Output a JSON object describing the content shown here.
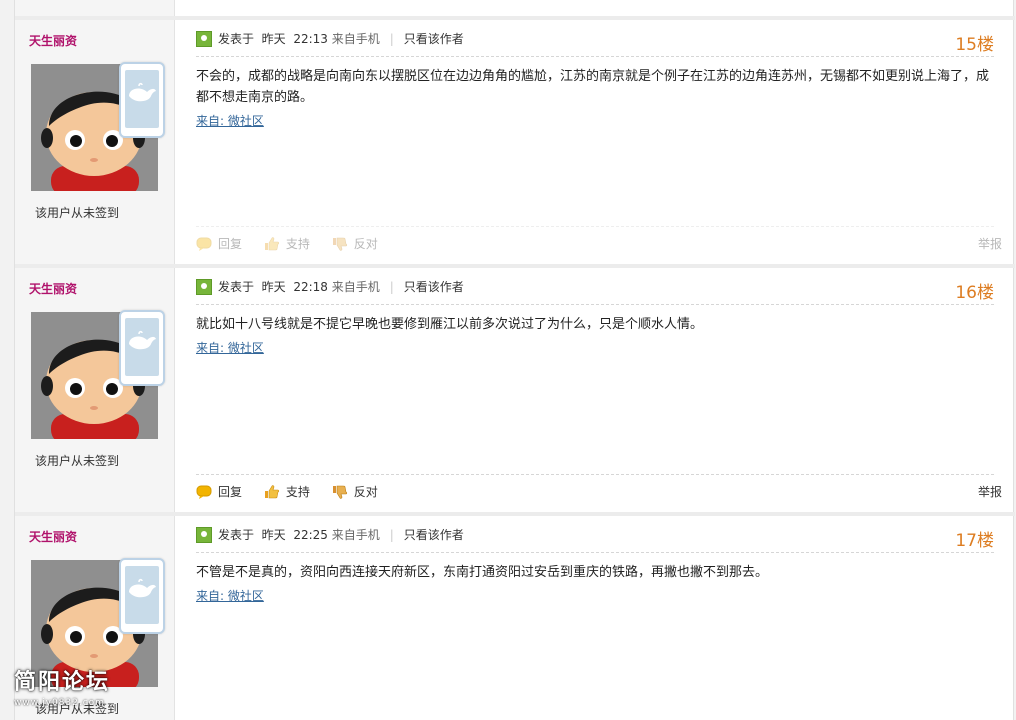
{
  "posts": [
    {
      "author": "天生丽资",
      "posted_label": "发表于",
      "date": "昨天",
      "time": "22:13",
      "device": "来自手机",
      "only_author": "只看该作者",
      "floor": "15楼",
      "content": "不会的，成都的战略是向南向东以摆脱区位在边边角角的尴尬，江苏的南京就是个例子在江苏的边角连苏州，无锡都不如更别说上海了，成都不想走南京的路。",
      "source": "来自: 微社区",
      "sign_status": "该用户从未签到",
      "reply": "回复",
      "support": "支持",
      "oppose": "反对",
      "report": "举报"
    },
    {
      "author": "天生丽资",
      "posted_label": "发表于",
      "date": "昨天",
      "time": "22:18",
      "device": "来自手机",
      "only_author": "只看该作者",
      "floor": "16楼",
      "content": "就比如十八号线就是不提它早晚也要修到雁江以前多次说过了为什么，只是个顺水人情。",
      "source": "来自: 微社区",
      "sign_status": "该用户从未签到",
      "reply": "回复",
      "support": "支持",
      "oppose": "反对",
      "report": "举报"
    },
    {
      "author": "天生丽资",
      "posted_label": "发表于",
      "date": "昨天",
      "time": "22:25",
      "device": "来自手机",
      "only_author": "只看该作者",
      "floor": "17楼",
      "content": "不管是不是真的，资阳向西连接天府新区，东南打通资阳过安岳到重庆的铁路，再撇也撇不到那去。",
      "source": "来自: 微社区",
      "sign_status": "该用户从未签到"
    }
  ],
  "watermark": {
    "title": "简阳论坛",
    "url": "www.jy0832.com"
  },
  "colors": {
    "author": "#b0126b",
    "floor": "#dd7d22",
    "link": "#336699"
  },
  "icons": {
    "post_tag": "post-tag-icon",
    "phone_badge": "mobile-phone-icon",
    "reply": "reply-icon",
    "support": "thumbs-up-icon",
    "oppose": "thumbs-down-icon"
  }
}
